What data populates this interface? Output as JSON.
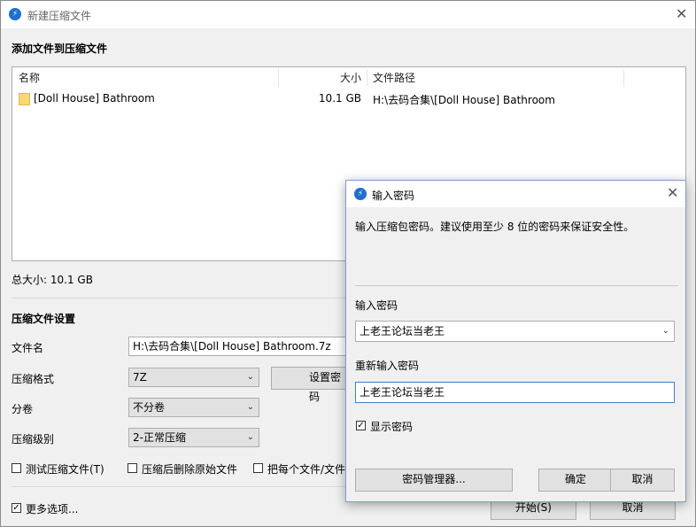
{
  "main": {
    "title": "新建压缩文件",
    "section_add": "添加文件到压缩文件",
    "columns": {
      "name": "名称",
      "size": "大小",
      "path": "文件路径"
    },
    "files": [
      {
        "name": "[Doll House] Bathroom",
        "size": "10.1 GB",
        "path": "H:\\去码合集\\[Doll House] Bathroom"
      }
    ],
    "total_size": "总大小: 10.1 GB",
    "section_settings": "压缩文件设置",
    "filename_label": "文件名",
    "filename_value": "H:\\去码合集\\[Doll House] Bathroom.7z",
    "format_label": "压缩格式",
    "format_value": "7Z",
    "set_password_label": "设置密码",
    "split_label": "分卷",
    "split_value": "不分卷",
    "level_label": "压缩级别",
    "level_value": "2-正常压缩",
    "opt_test": "测试压缩文件(T)",
    "opt_delete": "压缩后删除原始文件",
    "opt_each": "把每个文件/文件",
    "more_options": "更多选项...",
    "start_label": "开始(S)",
    "cancel_label": "取消"
  },
  "dialog": {
    "title": "输入密码",
    "hint": "输入压缩包密码。建议使用至少 8 位的密码来保证安全性。",
    "password_label": "输入密码",
    "password_value": "上老王论坛当老王",
    "confirm_label": "重新输入密码",
    "confirm_value": "上老王论坛当老王",
    "show_password": "显示密码",
    "manager_label": "密码管理器...",
    "ok_label": "确定",
    "cancel_label": "取消"
  },
  "icons": {
    "app": "app-logo-icon",
    "close": "close-icon",
    "folder": "folder-icon",
    "dropdown": "chevron-down-icon",
    "check": "check-icon"
  },
  "colors": {
    "logo": "#1f6fd0",
    "folder": "#f8d775",
    "dialog_border": "#7a9fce"
  }
}
